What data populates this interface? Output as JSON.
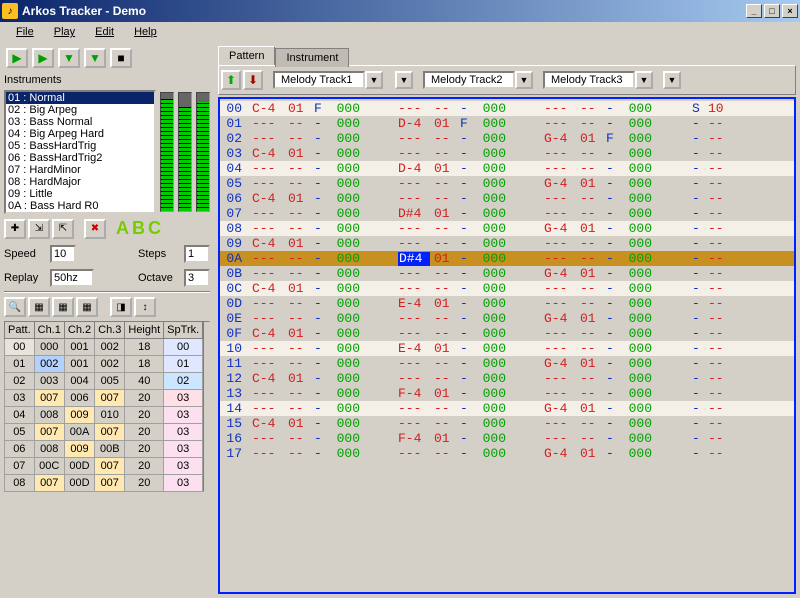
{
  "window": {
    "title": "Arkos Tracker - Demo"
  },
  "menu": [
    "File",
    "Play",
    "Edit",
    "Help"
  ],
  "instruments_label": "Instruments",
  "instruments": [
    "01 : Normal",
    "02 : Big Arpeg",
    "03 : Bass Normal",
    "04 : Big Arpeg Hard",
    "05 : BassHardTrig",
    "06 : BassHardTrig2",
    "07 : HardMinor",
    "08 : HardMajor",
    "09 : Little",
    "0A : Bass Hard R0"
  ],
  "vu_levels": [
    95,
    88,
    92
  ],
  "fields": {
    "speed_label": "Speed",
    "speed_value": "10",
    "steps_label": "Steps",
    "steps_value": "1",
    "replay_label": "Replay",
    "replay_value": "50hz",
    "octave_label": "Octave",
    "octave_value": "3"
  },
  "pat_headers": [
    "Patt.",
    "Ch.1",
    "Ch.2",
    "Ch.3",
    "Height",
    "SpTrk."
  ],
  "pat_rows": [
    [
      "00",
      "000",
      "001",
      "002",
      "18",
      "00"
    ],
    [
      "01",
      "002",
      "001",
      "002",
      "18",
      "01"
    ],
    [
      "02",
      "003",
      "004",
      "005",
      "40",
      "02"
    ],
    [
      "03",
      "007",
      "006",
      "007",
      "20",
      "03"
    ],
    [
      "04",
      "008",
      "009",
      "010",
      "20",
      "03"
    ],
    [
      "05",
      "007",
      "00A",
      "007",
      "20",
      "03"
    ],
    [
      "06",
      "008",
      "009",
      "00B",
      "20",
      "03"
    ],
    [
      "07",
      "00C",
      "00D",
      "007",
      "20",
      "03"
    ],
    [
      "08",
      "007",
      "00D",
      "007",
      "20",
      "03"
    ]
  ],
  "pat_colors": {
    "01_1": "#b3d1ff",
    "04_5": "#fde0ef",
    "05_5": "#fde0ef",
    "06_5": "#fde0ef",
    "07_5": "#fde0ef",
    "08_5": "#fde0ef",
    "03_1": "#ffe9b0",
    "03_3": "#ffe9b0",
    "05_1": "#ffe9b0",
    "05_3": "#ffe9b0",
    "07_3": "#ffe9b0",
    "08_1": "#ffe9b0",
    "08_3": "#ffe9b0",
    "04_2": "#ffe9b0",
    "06_2": "#ffe9b0",
    "02_5": "#cde6ff",
    "03_5": "#ffe0e6",
    "00_5": "#e0e8ff",
    "01_5": "#e0e8ff"
  },
  "tabs": {
    "pattern": "Pattern",
    "instrument": "Instrument"
  },
  "tracks": [
    "Melody Track1",
    "Melody Track2",
    "Melody Track3"
  ],
  "chart_data": {
    "type": "table",
    "title": "Pattern rows",
    "columns": [
      "row",
      "t1_note",
      "t1_inst",
      "t1_vol",
      "t1_fx",
      "t2_note",
      "t2_inst",
      "t2_vol",
      "t2_fx",
      "t3_note",
      "t3_inst",
      "t3_vol",
      "t3_fx",
      "sp_a",
      "sp_b"
    ],
    "highlight_rows": [
      "00",
      "04",
      "08",
      "0C",
      "10",
      "14"
    ],
    "cursor_row": "0A",
    "cursor_cell": {
      "row": "0A",
      "track": 2,
      "field": "note"
    },
    "rows": [
      {
        "row": "00",
        "t1": [
          "C-4",
          "01",
          "F",
          "000"
        ],
        "t2": [
          "---",
          "--",
          "-",
          "000"
        ],
        "t3": [
          "---",
          "--",
          "-",
          "000"
        ],
        "sp": [
          "S",
          "10"
        ]
      },
      {
        "row": "01",
        "t1": [
          "---",
          "--",
          "-",
          "000"
        ],
        "t2": [
          "D-4",
          "01",
          "F",
          "000"
        ],
        "t3": [
          "---",
          "--",
          "-",
          "000"
        ],
        "sp": [
          "-",
          "--"
        ]
      },
      {
        "row": "02",
        "t1": [
          "---",
          "--",
          "-",
          "000"
        ],
        "t2": [
          "---",
          "--",
          "-",
          "000"
        ],
        "t3": [
          "G-4",
          "01",
          "F",
          "000"
        ],
        "sp": [
          "-",
          "--"
        ]
      },
      {
        "row": "03",
        "t1": [
          "C-4",
          "01",
          "-",
          "000"
        ],
        "t2": [
          "---",
          "--",
          "-",
          "000"
        ],
        "t3": [
          "---",
          "--",
          "-",
          "000"
        ],
        "sp": [
          "-",
          "--"
        ]
      },
      {
        "row": "04",
        "t1": [
          "---",
          "--",
          "-",
          "000"
        ],
        "t2": [
          "D-4",
          "01",
          "-",
          "000"
        ],
        "t3": [
          "---",
          "--",
          "-",
          "000"
        ],
        "sp": [
          "-",
          "--"
        ]
      },
      {
        "row": "05",
        "t1": [
          "---",
          "--",
          "-",
          "000"
        ],
        "t2": [
          "---",
          "--",
          "-",
          "000"
        ],
        "t3": [
          "G-4",
          "01",
          "-",
          "000"
        ],
        "sp": [
          "-",
          "--"
        ]
      },
      {
        "row": "06",
        "t1": [
          "C-4",
          "01",
          "-",
          "000"
        ],
        "t2": [
          "---",
          "--",
          "-",
          "000"
        ],
        "t3": [
          "---",
          "--",
          "-",
          "000"
        ],
        "sp": [
          "-",
          "--"
        ]
      },
      {
        "row": "07",
        "t1": [
          "---",
          "--",
          "-",
          "000"
        ],
        "t2": [
          "D#4",
          "01",
          "-",
          "000"
        ],
        "t3": [
          "---",
          "--",
          "-",
          "000"
        ],
        "sp": [
          "-",
          "--"
        ]
      },
      {
        "row": "08",
        "t1": [
          "---",
          "--",
          "-",
          "000"
        ],
        "t2": [
          "---",
          "--",
          "-",
          "000"
        ],
        "t3": [
          "G-4",
          "01",
          "-",
          "000"
        ],
        "sp": [
          "-",
          "--"
        ]
      },
      {
        "row": "09",
        "t1": [
          "C-4",
          "01",
          "-",
          "000"
        ],
        "t2": [
          "---",
          "--",
          "-",
          "000"
        ],
        "t3": [
          "---",
          "--",
          "-",
          "000"
        ],
        "sp": [
          "-",
          "--"
        ]
      },
      {
        "row": "0A",
        "t1": [
          "---",
          "--",
          "-",
          "000"
        ],
        "t2": [
          "D#4",
          "01",
          "-",
          "000"
        ],
        "t3": [
          "---",
          "--",
          "-",
          "000"
        ],
        "sp": [
          "-",
          "--"
        ]
      },
      {
        "row": "0B",
        "t1": [
          "---",
          "--",
          "-",
          "000"
        ],
        "t2": [
          "---",
          "--",
          "-",
          "000"
        ],
        "t3": [
          "G-4",
          "01",
          "-",
          "000"
        ],
        "sp": [
          "-",
          "--"
        ]
      },
      {
        "row": "0C",
        "t1": [
          "C-4",
          "01",
          "-",
          "000"
        ],
        "t2": [
          "---",
          "--",
          "-",
          "000"
        ],
        "t3": [
          "---",
          "--",
          "-",
          "000"
        ],
        "sp": [
          "-",
          "--"
        ]
      },
      {
        "row": "0D",
        "t1": [
          "---",
          "--",
          "-",
          "000"
        ],
        "t2": [
          "E-4",
          "01",
          "-",
          "000"
        ],
        "t3": [
          "---",
          "--",
          "-",
          "000"
        ],
        "sp": [
          "-",
          "--"
        ]
      },
      {
        "row": "0E",
        "t1": [
          "---",
          "--",
          "-",
          "000"
        ],
        "t2": [
          "---",
          "--",
          "-",
          "000"
        ],
        "t3": [
          "G-4",
          "01",
          "-",
          "000"
        ],
        "sp": [
          "-",
          "--"
        ]
      },
      {
        "row": "0F",
        "t1": [
          "C-4",
          "01",
          "-",
          "000"
        ],
        "t2": [
          "---",
          "--",
          "-",
          "000"
        ],
        "t3": [
          "---",
          "--",
          "-",
          "000"
        ],
        "sp": [
          "-",
          "--"
        ]
      },
      {
        "row": "10",
        "t1": [
          "---",
          "--",
          "-",
          "000"
        ],
        "t2": [
          "E-4",
          "01",
          "-",
          "000"
        ],
        "t3": [
          "---",
          "--",
          "-",
          "000"
        ],
        "sp": [
          "-",
          "--"
        ]
      },
      {
        "row": "11",
        "t1": [
          "---",
          "--",
          "-",
          "000"
        ],
        "t2": [
          "---",
          "--",
          "-",
          "000"
        ],
        "t3": [
          "G-4",
          "01",
          "-",
          "000"
        ],
        "sp": [
          "-",
          "--"
        ]
      },
      {
        "row": "12",
        "t1": [
          "C-4",
          "01",
          "-",
          "000"
        ],
        "t2": [
          "---",
          "--",
          "-",
          "000"
        ],
        "t3": [
          "---",
          "--",
          "-",
          "000"
        ],
        "sp": [
          "-",
          "--"
        ]
      },
      {
        "row": "13",
        "t1": [
          "---",
          "--",
          "-",
          "000"
        ],
        "t2": [
          "F-4",
          "01",
          "-",
          "000"
        ],
        "t3": [
          "---",
          "--",
          "-",
          "000"
        ],
        "sp": [
          "-",
          "--"
        ]
      },
      {
        "row": "14",
        "t1": [
          "---",
          "--",
          "-",
          "000"
        ],
        "t2": [
          "---",
          "--",
          "-",
          "000"
        ],
        "t3": [
          "G-4",
          "01",
          "-",
          "000"
        ],
        "sp": [
          "-",
          "--"
        ]
      },
      {
        "row": "15",
        "t1": [
          "C-4",
          "01",
          "-",
          "000"
        ],
        "t2": [
          "---",
          "--",
          "-",
          "000"
        ],
        "t3": [
          "---",
          "--",
          "-",
          "000"
        ],
        "sp": [
          "-",
          "--"
        ]
      },
      {
        "row": "16",
        "t1": [
          "---",
          "--",
          "-",
          "000"
        ],
        "t2": [
          "F-4",
          "01",
          "-",
          "000"
        ],
        "t3": [
          "---",
          "--",
          "-",
          "000"
        ],
        "sp": [
          "-",
          "--"
        ]
      },
      {
        "row": "17",
        "t1": [
          "---",
          "--",
          "-",
          "000"
        ],
        "t2": [
          "---",
          "--",
          "-",
          "000"
        ],
        "t3": [
          "G-4",
          "01",
          "-",
          "000"
        ],
        "sp": [
          "-",
          "--"
        ]
      }
    ]
  }
}
